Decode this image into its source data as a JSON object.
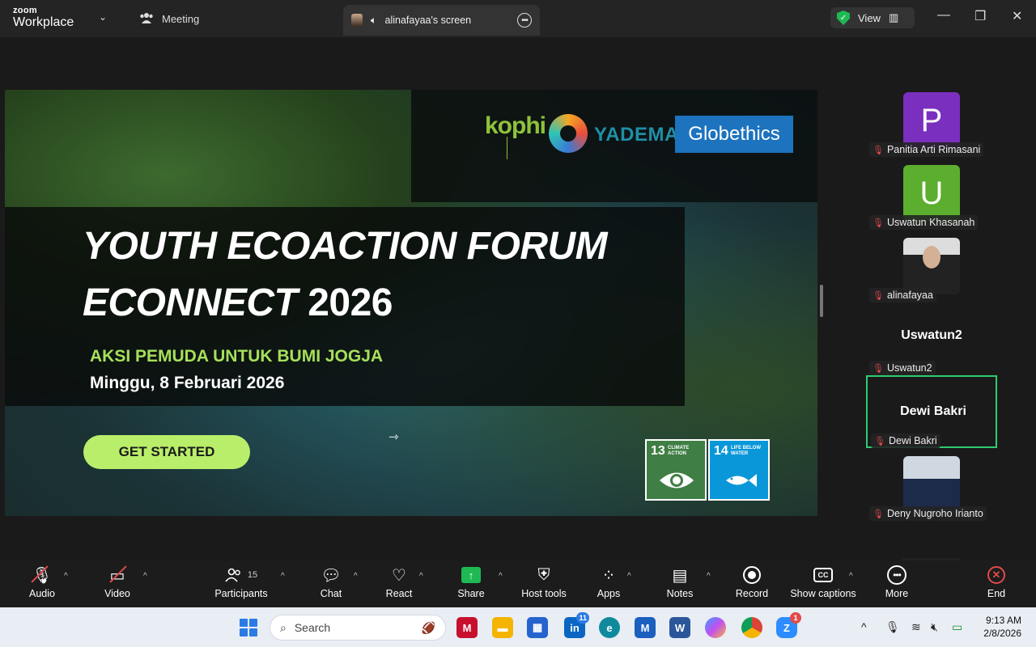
{
  "titlebar": {
    "brand_top": "zoom",
    "brand_bottom": "Workplace",
    "meeting_label": "Meeting",
    "screen_tab_label": "alinafayaa's screen",
    "view_label": "View"
  },
  "slide": {
    "title_line1": "YOUTH ECOACTION FORUM",
    "title_line2_word": "ECONNECT",
    "title_line2_year": "2026",
    "subtitle": "AKSI PEMUDA UNTUK BUMI JOGJA",
    "date": "Minggu, 8 Februari 2026",
    "cta": "GET STARTED",
    "logos": {
      "kophi": "kophi",
      "yadema": "YADEMA",
      "globethics": "Globethics"
    },
    "sdg13": {
      "num": "13",
      "label": "CLIMATE ACTION"
    },
    "sdg14": {
      "num": "14",
      "label": "LIFE BELOW WATER"
    }
  },
  "participants": [
    {
      "name": "Panitia Arti Rimasani",
      "initial": "P",
      "color": "#7b2fbf"
    },
    {
      "name": "Uswatun Khasanah",
      "initial": "U",
      "color": "#5cae2e"
    },
    {
      "name": "alinafayaa"
    },
    {
      "name": "Uswatun2",
      "big": "Uswatun2"
    },
    {
      "name": "Dewi Bakri",
      "big": "Dewi Bakri"
    },
    {
      "name": "Deny Nugroho Irianto"
    }
  ],
  "toolbar": {
    "audio": "Audio",
    "video": "Video",
    "participants": "Participants",
    "participants_count": "15",
    "chat": "Chat",
    "react": "React",
    "share": "Share",
    "host_tools": "Host tools",
    "apps": "Apps",
    "notes": "Notes",
    "record": "Record",
    "captions": "Show captions",
    "more": "More",
    "end": "End"
  },
  "taskbar": {
    "search_placeholder": "Search",
    "time": "9:13 AM",
    "date": "2/8/2026",
    "linkedin_badge": "11",
    "zoom_badge": "1"
  }
}
